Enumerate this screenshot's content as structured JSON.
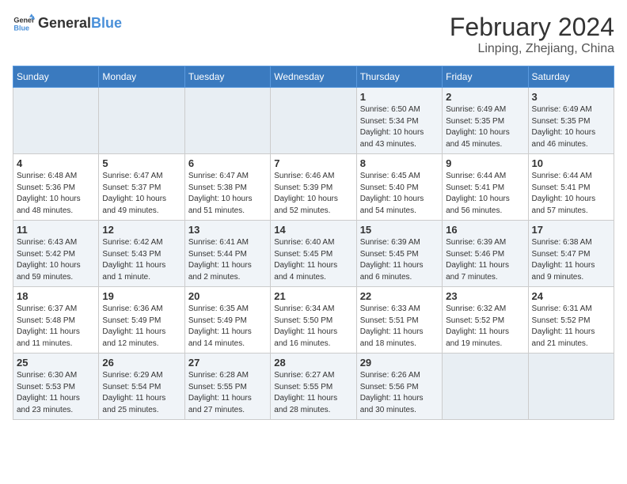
{
  "header": {
    "logo_line1": "General",
    "logo_line2": "Blue",
    "month": "February 2024",
    "location": "Linping, Zhejiang, China"
  },
  "weekdays": [
    "Sunday",
    "Monday",
    "Tuesday",
    "Wednesday",
    "Thursday",
    "Friday",
    "Saturday"
  ],
  "weeks": [
    {
      "days": [
        {
          "num": "",
          "info": ""
        },
        {
          "num": "",
          "info": ""
        },
        {
          "num": "",
          "info": ""
        },
        {
          "num": "",
          "info": ""
        },
        {
          "num": "1",
          "info": "Sunrise: 6:50 AM\nSunset: 5:34 PM\nDaylight: 10 hours\nand 43 minutes."
        },
        {
          "num": "2",
          "info": "Sunrise: 6:49 AM\nSunset: 5:35 PM\nDaylight: 10 hours\nand 45 minutes."
        },
        {
          "num": "3",
          "info": "Sunrise: 6:49 AM\nSunset: 5:35 PM\nDaylight: 10 hours\nand 46 minutes."
        }
      ]
    },
    {
      "days": [
        {
          "num": "4",
          "info": "Sunrise: 6:48 AM\nSunset: 5:36 PM\nDaylight: 10 hours\nand 48 minutes."
        },
        {
          "num": "5",
          "info": "Sunrise: 6:47 AM\nSunset: 5:37 PM\nDaylight: 10 hours\nand 49 minutes."
        },
        {
          "num": "6",
          "info": "Sunrise: 6:47 AM\nSunset: 5:38 PM\nDaylight: 10 hours\nand 51 minutes."
        },
        {
          "num": "7",
          "info": "Sunrise: 6:46 AM\nSunset: 5:39 PM\nDaylight: 10 hours\nand 52 minutes."
        },
        {
          "num": "8",
          "info": "Sunrise: 6:45 AM\nSunset: 5:40 PM\nDaylight: 10 hours\nand 54 minutes."
        },
        {
          "num": "9",
          "info": "Sunrise: 6:44 AM\nSunset: 5:41 PM\nDaylight: 10 hours\nand 56 minutes."
        },
        {
          "num": "10",
          "info": "Sunrise: 6:44 AM\nSunset: 5:41 PM\nDaylight: 10 hours\nand 57 minutes."
        }
      ]
    },
    {
      "days": [
        {
          "num": "11",
          "info": "Sunrise: 6:43 AM\nSunset: 5:42 PM\nDaylight: 10 hours\nand 59 minutes."
        },
        {
          "num": "12",
          "info": "Sunrise: 6:42 AM\nSunset: 5:43 PM\nDaylight: 11 hours\nand 1 minute."
        },
        {
          "num": "13",
          "info": "Sunrise: 6:41 AM\nSunset: 5:44 PM\nDaylight: 11 hours\nand 2 minutes."
        },
        {
          "num": "14",
          "info": "Sunrise: 6:40 AM\nSunset: 5:45 PM\nDaylight: 11 hours\nand 4 minutes."
        },
        {
          "num": "15",
          "info": "Sunrise: 6:39 AM\nSunset: 5:45 PM\nDaylight: 11 hours\nand 6 minutes."
        },
        {
          "num": "16",
          "info": "Sunrise: 6:39 AM\nSunset: 5:46 PM\nDaylight: 11 hours\nand 7 minutes."
        },
        {
          "num": "17",
          "info": "Sunrise: 6:38 AM\nSunset: 5:47 PM\nDaylight: 11 hours\nand 9 minutes."
        }
      ]
    },
    {
      "days": [
        {
          "num": "18",
          "info": "Sunrise: 6:37 AM\nSunset: 5:48 PM\nDaylight: 11 hours\nand 11 minutes."
        },
        {
          "num": "19",
          "info": "Sunrise: 6:36 AM\nSunset: 5:49 PM\nDaylight: 11 hours\nand 12 minutes."
        },
        {
          "num": "20",
          "info": "Sunrise: 6:35 AM\nSunset: 5:49 PM\nDaylight: 11 hours\nand 14 minutes."
        },
        {
          "num": "21",
          "info": "Sunrise: 6:34 AM\nSunset: 5:50 PM\nDaylight: 11 hours\nand 16 minutes."
        },
        {
          "num": "22",
          "info": "Sunrise: 6:33 AM\nSunset: 5:51 PM\nDaylight: 11 hours\nand 18 minutes."
        },
        {
          "num": "23",
          "info": "Sunrise: 6:32 AM\nSunset: 5:52 PM\nDaylight: 11 hours\nand 19 minutes."
        },
        {
          "num": "24",
          "info": "Sunrise: 6:31 AM\nSunset: 5:52 PM\nDaylight: 11 hours\nand 21 minutes."
        }
      ]
    },
    {
      "days": [
        {
          "num": "25",
          "info": "Sunrise: 6:30 AM\nSunset: 5:53 PM\nDaylight: 11 hours\nand 23 minutes."
        },
        {
          "num": "26",
          "info": "Sunrise: 6:29 AM\nSunset: 5:54 PM\nDaylight: 11 hours\nand 25 minutes."
        },
        {
          "num": "27",
          "info": "Sunrise: 6:28 AM\nSunset: 5:55 PM\nDaylight: 11 hours\nand 27 minutes."
        },
        {
          "num": "28",
          "info": "Sunrise: 6:27 AM\nSunset: 5:55 PM\nDaylight: 11 hours\nand 28 minutes."
        },
        {
          "num": "29",
          "info": "Sunrise: 6:26 AM\nSunset: 5:56 PM\nDaylight: 11 hours\nand 30 minutes."
        },
        {
          "num": "",
          "info": ""
        },
        {
          "num": "",
          "info": ""
        }
      ]
    }
  ]
}
